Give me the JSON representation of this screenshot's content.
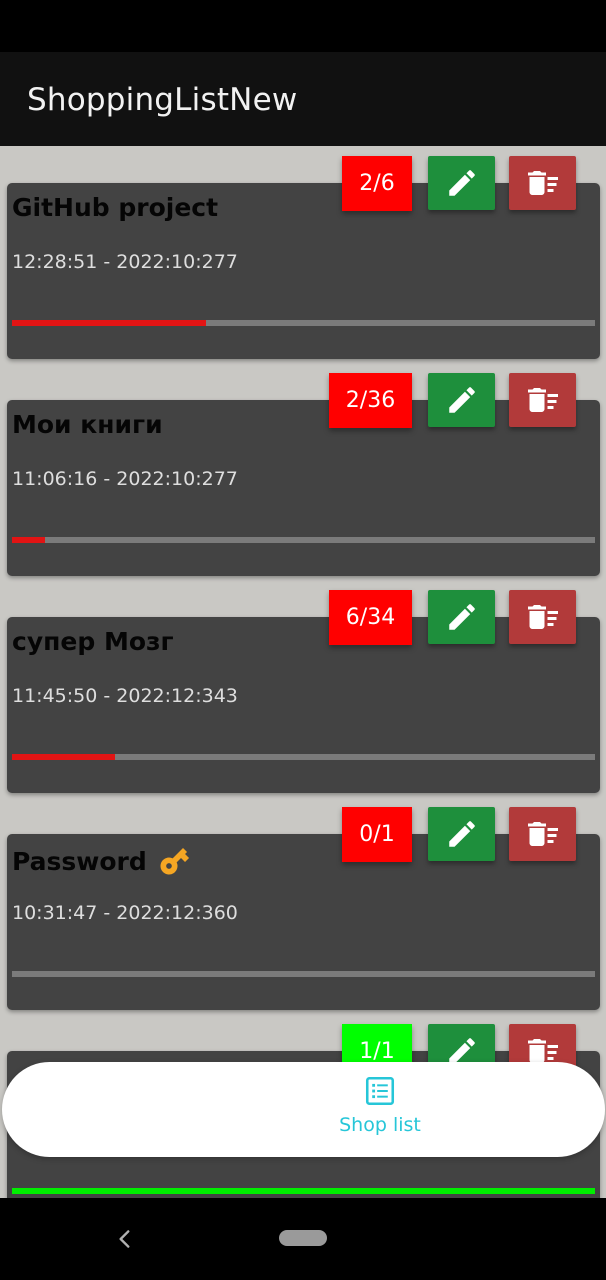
{
  "app": {
    "title": "ShoppingListNew"
  },
  "lists": [
    {
      "title": "GitHub project",
      "time": "12:28:51 - 2022:10:277",
      "counter": "2/6",
      "progress": 0.333,
      "bar_color": "#e21414",
      "counter_color": "#ff0000"
    },
    {
      "title": "Мои книги",
      "time": "11:06:16 - 2022:10:277",
      "counter": "2/36",
      "progress": 0.056,
      "bar_color": "#e21414",
      "counter_color": "#ff0000"
    },
    {
      "title": "супер Мозг",
      "time": "11:45:50 - 2022:12:343",
      "counter": "6/34",
      "progress": 0.176,
      "bar_color": "#e21414",
      "counter_color": "#ff0000"
    },
    {
      "title": "Password",
      "title_icon": "key-icon",
      "time": "10:31:47 - 2022:12:360",
      "counter": "0/1",
      "progress": 0,
      "bar_color": "#e21414",
      "counter_color": "#ff0000"
    },
    {
      "title": "",
      "time": "",
      "counter": "1/1",
      "progress": 1,
      "bar_color": "#00ee00",
      "counter_color": "#00ff00"
    }
  ],
  "buttons": {
    "edit_icon": "pencil-icon",
    "delete_icon": "delete-sweep-icon"
  },
  "bottom_nav": {
    "label": "Shop list",
    "icon": "list-icon",
    "color": "#26c6d8"
  },
  "system_nav": {
    "back_icon": "back-chevron-icon",
    "home_icon": "home-pill"
  }
}
